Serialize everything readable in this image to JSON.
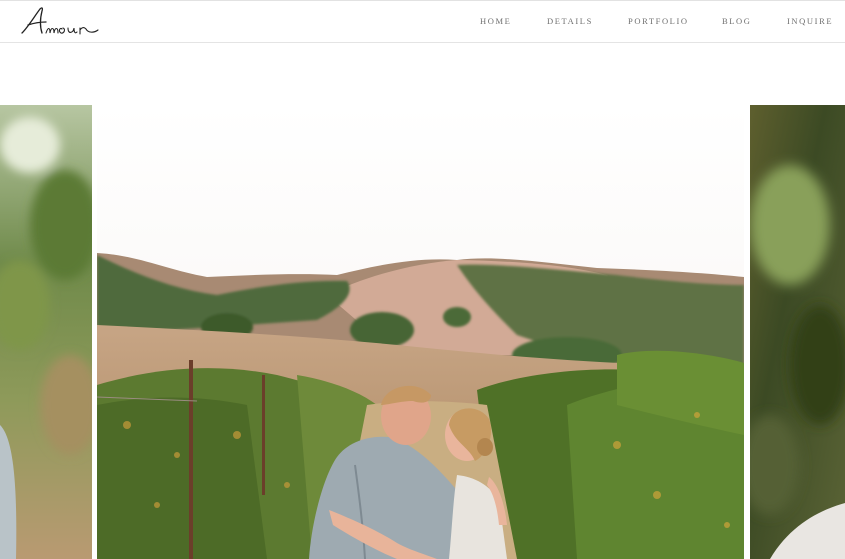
{
  "brand": {
    "logo_text": "Amour"
  },
  "nav": {
    "items": [
      {
        "label": "HOME"
      },
      {
        "label": "DETAILS"
      },
      {
        "label": "PORTFOLIO"
      },
      {
        "label": "BLOG"
      },
      {
        "label": "INQUIRE"
      }
    ]
  },
  "colors": {
    "sky": "#fbf9f7",
    "hills": "#c9a48e",
    "trees": "#4f6a3c",
    "vines": "#5f7e33",
    "jacket": "#9eaab1",
    "hair": "#c79b63"
  },
  "slider": {
    "slides": [
      {
        "name": "previous-photo"
      },
      {
        "name": "vineyard-couple-photo"
      },
      {
        "name": "next-photo"
      }
    ]
  }
}
